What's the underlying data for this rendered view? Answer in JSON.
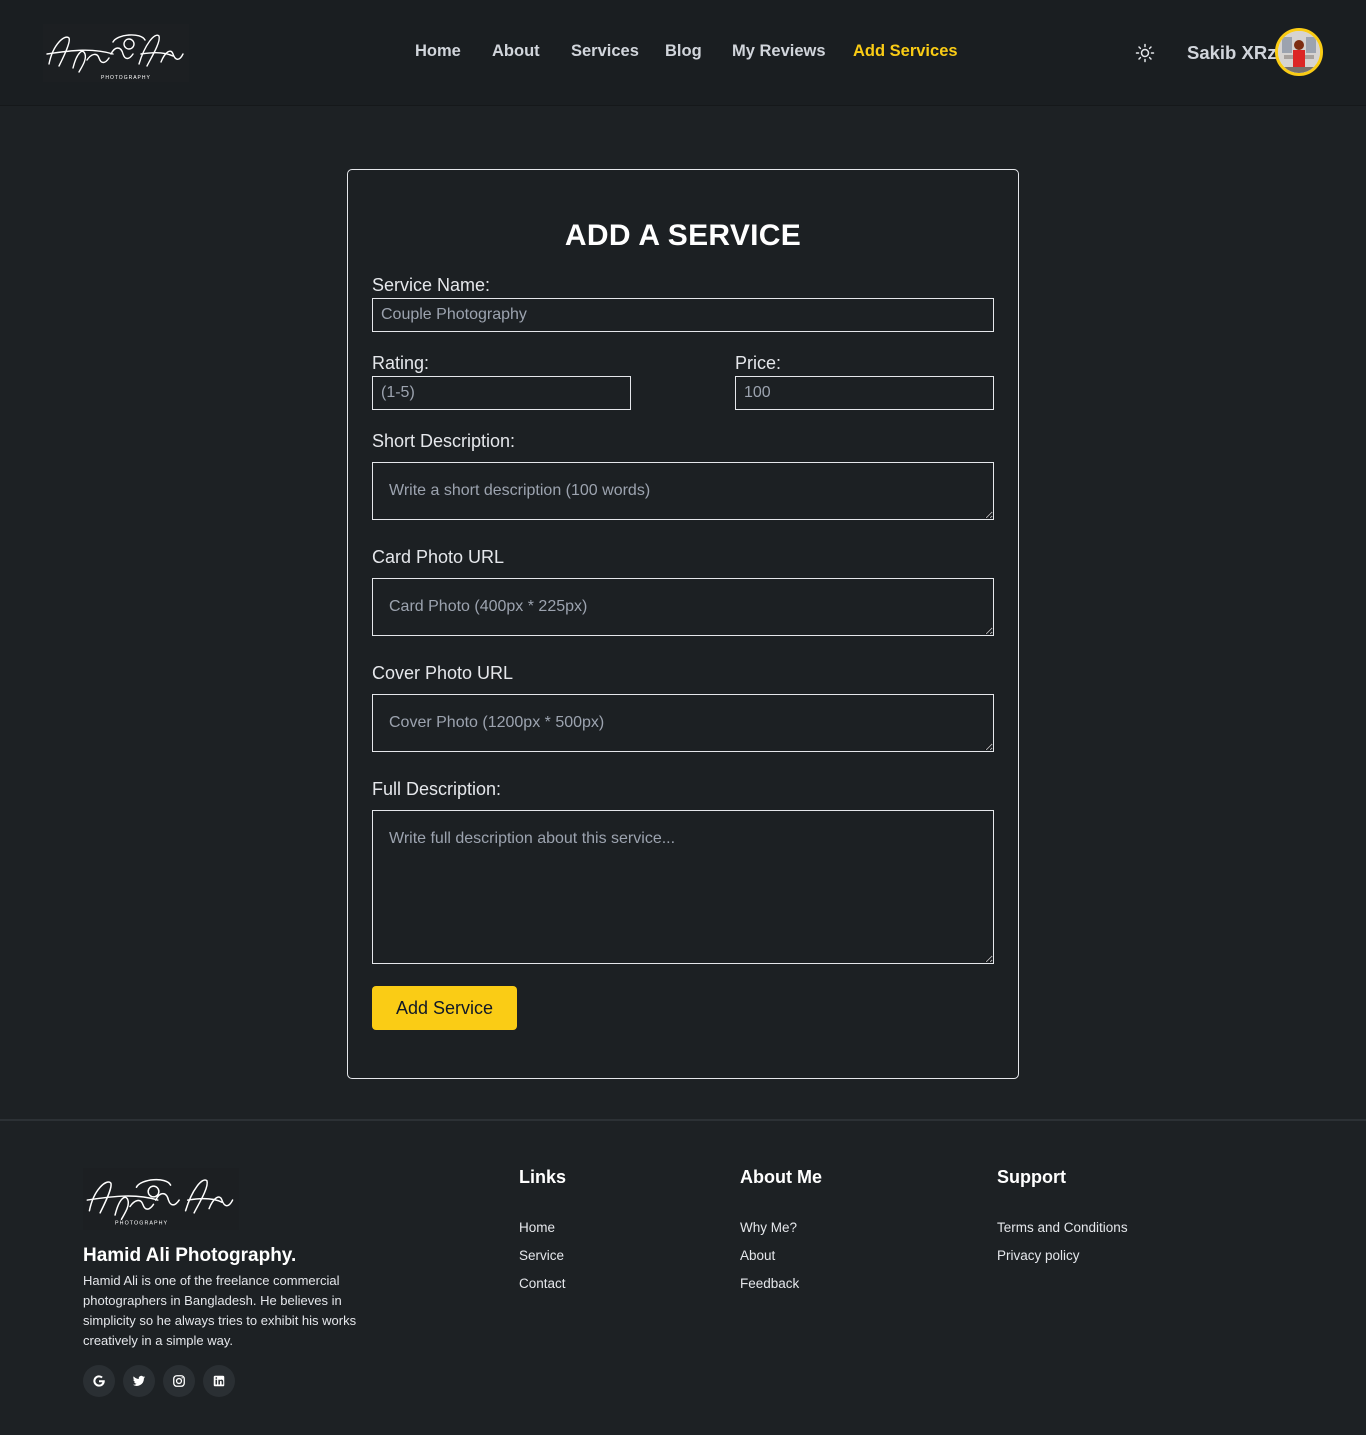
{
  "brand": {
    "logo_text": "Hamid Ali",
    "logo_subtext": "PHOTOGRAPHY"
  },
  "nav": {
    "links": [
      "Home",
      "About",
      "Services",
      "Blog",
      "My Reviews",
      "Add Services"
    ],
    "active_index": 5,
    "theme_icon": "sun-icon",
    "user_name": "Sakib XRz"
  },
  "form": {
    "title": "ADD A SERVICE",
    "service_name": {
      "label": "Service Name:",
      "value": "Couple Photography"
    },
    "rating": {
      "label": "Rating:",
      "placeholder": "(1-5)"
    },
    "price": {
      "label": "Price:",
      "value": "100"
    },
    "short_description": {
      "label": "Short Description:",
      "placeholder": "Write a short description (100 words)"
    },
    "card_photo": {
      "label": "Card Photo URL",
      "placeholder": "Card Photo (400px * 225px)"
    },
    "cover_photo": {
      "label": "Cover Photo URL",
      "placeholder": "Cover Photo (1200px * 500px)"
    },
    "full_description": {
      "label": "Full Description:",
      "placeholder": "Write full description about this service..."
    },
    "submit_label": "Add Service"
  },
  "footer": {
    "brand": "Hamid Ali Photography.",
    "description": "Hamid Ali is one of the freelance commercial photographers in Bangladesh. He believes in simplicity so he always tries to exhibit his works creatively in a simple way.",
    "socials": [
      "google-icon",
      "twitter-icon",
      "instagram-icon",
      "linkedin-icon"
    ],
    "columns": [
      {
        "heading": "Links",
        "items": [
          "Home",
          "Service",
          "Contact"
        ]
      },
      {
        "heading": "About Me",
        "items": [
          "Why Me?",
          "About",
          "Feedback"
        ]
      },
      {
        "heading": "Support",
        "items": [
          "Terms and Conditions",
          "Privacy policy"
        ]
      }
    ]
  },
  "colors": {
    "background": "#1d2124",
    "accent": "#facc15",
    "text": "#e5e7eb"
  }
}
